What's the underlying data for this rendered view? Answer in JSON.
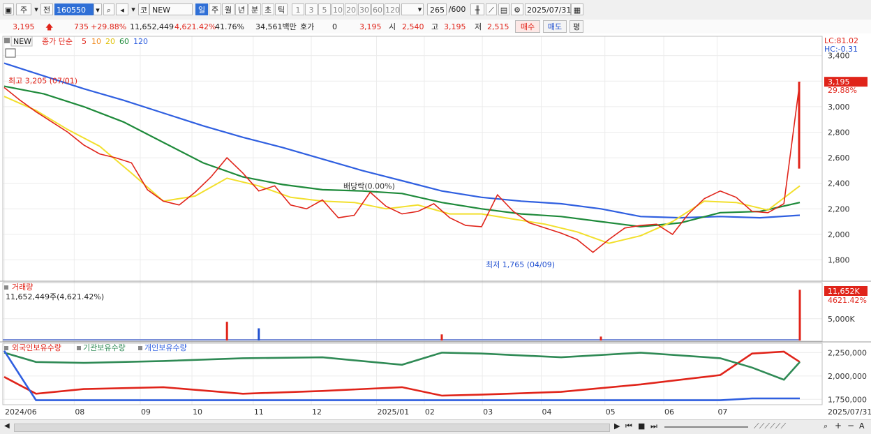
{
  "toolbar": {
    "market": "주",
    "prefix": "전",
    "code": "160550",
    "type_label": "코",
    "name": "NEW",
    "periods": [
      "일",
      "주",
      "월",
      "년",
      "분",
      "초",
      "틱"
    ],
    "intervals": [
      "1",
      "3",
      "5",
      "10",
      "20",
      "30",
      "60",
      "120"
    ],
    "count": "265",
    "count_max": "/600",
    "date": "2025/07/31"
  },
  "quote": {
    "price": "3,195",
    "change": "735",
    "change_pct": "+29.88%",
    "volume": "11,652,449",
    "volume_pct": "4,621.42%",
    "turnover": "41.76%",
    "amount": "34,561백만",
    "hoga_label": "호가",
    "hoga_value": "0",
    "hoga_price": "3,195",
    "open_label": "시",
    "open": "2,540",
    "high_label": "고",
    "high": "3,195",
    "low_label": "저",
    "low": "2,515",
    "buy_label": "매수",
    "sell_label": "매도",
    "avg_label": "평"
  },
  "colors": {
    "ma5": "#e0241a",
    "ma10": "#f08a1e",
    "ma20": "#f2df2c",
    "ma60": "#1e8a3a",
    "ma120": "#2f5fe0",
    "up": "#e0241a",
    "down": "#1f4fd0",
    "foreign": "#e0241a",
    "institution": "#2f8a55",
    "individual": "#2f5fe0"
  },
  "legend": {
    "name": "NEW",
    "price_legend": "종가 단순",
    "ma_periods": [
      "5",
      "10",
      "20",
      "60",
      "120"
    ],
    "volume_title": "거래량",
    "volume_value": "11,652,449주(4,621.42%)",
    "holding": [
      "외국인보유수량",
      "기관보유수량",
      "개인보유수량"
    ]
  },
  "chart_data": [
    {
      "type": "line",
      "title": "",
      "y_ticks": [
        "3,400",
        "3,200",
        "3,000",
        "2,800",
        "2,600",
        "2,400",
        "2,200",
        "2,000",
        "1,800"
      ],
      "x_ticks": [
        "2024/06",
        "08",
        "09",
        "10",
        "11",
        "12",
        "2025/01",
        "02",
        "03",
        "04",
        "05",
        "06",
        "07"
      ],
      "ylim": [
        1650,
        3540
      ],
      "lc": "LC:81.02",
      "hc": "HC:-0.31",
      "current_label": "3,195",
      "current_pct": "29.88%",
      "annotations": {
        "max": "최고 3,205 (07/01)",
        "min": "최저 1,765 (04/09)",
        "dividend": "배당락(0.00%)"
      },
      "series": [
        {
          "key": "close",
          "x": [
            0,
            0.02,
            0.04,
            0.06,
            0.08,
            0.1,
            0.12,
            0.14,
            0.16,
            0.18,
            0.2,
            0.22,
            0.24,
            0.26,
            0.28,
            0.3,
            0.32,
            0.34,
            0.36,
            0.38,
            0.4,
            0.42,
            0.44,
            0.46,
            0.48,
            0.5,
            0.52,
            0.54,
            0.56,
            0.58,
            0.6,
            0.62,
            0.64,
            0.66,
            0.68,
            0.7,
            0.72,
            0.74,
            0.76,
            0.78,
            0.8,
            0.82,
            0.84,
            0.86,
            0.88,
            0.9,
            0.92,
            0.94,
            0.96,
            0.98,
            1.0
          ],
          "values": [
            3150,
            3050,
            2960,
            2880,
            2800,
            2700,
            2630,
            2600,
            2560,
            2350,
            2260,
            2230,
            2330,
            2450,
            2600,
            2480,
            2340,
            2380,
            2230,
            2200,
            2270,
            2130,
            2150,
            2330,
            2220,
            2160,
            2180,
            2240,
            2130,
            2070,
            2060,
            2310,
            2180,
            2090,
            2050,
            2010,
            1960,
            1860,
            1960,
            2050,
            2070,
            2080,
            2000,
            2160,
            2280,
            2340,
            2290,
            2180,
            2170,
            2240,
            3195
          ]
        },
        {
          "key": "ma120",
          "x": [
            0,
            0.05,
            0.1,
            0.15,
            0.2,
            0.25,
            0.3,
            0.35,
            0.4,
            0.45,
            0.5,
            0.55,
            0.6,
            0.65,
            0.7,
            0.75,
            0.8,
            0.85,
            0.9,
            0.95,
            1.0
          ],
          "values": [
            3340,
            3240,
            3140,
            3050,
            2950,
            2850,
            2760,
            2680,
            2590,
            2500,
            2420,
            2340,
            2290,
            2260,
            2240,
            2200,
            2140,
            2130,
            2140,
            2130,
            2150
          ]
        },
        {
          "key": "ma60",
          "x": [
            0,
            0.05,
            0.1,
            0.15,
            0.2,
            0.25,
            0.3,
            0.35,
            0.4,
            0.45,
            0.5,
            0.55,
            0.6,
            0.65,
            0.7,
            0.75,
            0.8,
            0.85,
            0.9,
            0.95,
            1.0
          ],
          "values": [
            3160,
            3100,
            3000,
            2880,
            2720,
            2560,
            2450,
            2390,
            2350,
            2340,
            2320,
            2250,
            2200,
            2160,
            2140,
            2100,
            2060,
            2090,
            2170,
            2180,
            2250
          ]
        },
        {
          "key": "ma20",
          "x": [
            0,
            0.04,
            0.08,
            0.12,
            0.16,
            0.2,
            0.24,
            0.28,
            0.32,
            0.36,
            0.4,
            0.44,
            0.48,
            0.52,
            0.56,
            0.6,
            0.64,
            0.68,
            0.72,
            0.76,
            0.8,
            0.84,
            0.88,
            0.92,
            0.96,
            1.0
          ],
          "values": [
            3080,
            2970,
            2820,
            2690,
            2480,
            2260,
            2300,
            2440,
            2380,
            2290,
            2260,
            2250,
            2200,
            2230,
            2160,
            2160,
            2120,
            2080,
            2020,
            1930,
            1990,
            2100,
            2260,
            2250,
            2190,
            2380
          ]
        }
      ]
    },
    {
      "type": "bar",
      "title": "거래량",
      "y_ticks": [
        "5,000K"
      ],
      "current_label": "11,652K",
      "current_pct": "4621.42%",
      "ylim": [
        0,
        12500000
      ],
      "x": [
        0.28,
        0.32,
        0.55,
        0.75,
        1.0
      ],
      "values": [
        4300000,
        2800000,
        1400000,
        900000,
        11652449
      ]
    },
    {
      "type": "line",
      "title": "외국인보유수량",
      "y_ticks": [
        "2,250,000",
        "2,000,000",
        "1,750,000"
      ],
      "ylim": [
        1700000,
        2320000
      ],
      "series": [
        {
          "key": "foreign",
          "x": [
            0,
            0.04,
            0.1,
            0.2,
            0.3,
            0.4,
            0.5,
            0.55,
            0.6,
            0.7,
            0.8,
            0.9,
            0.94,
            0.98,
            1.0
          ],
          "values": [
            1990000,
            1810000,
            1860000,
            1880000,
            1810000,
            1840000,
            1880000,
            1790000,
            1800000,
            1830000,
            1910000,
            2010000,
            2240000,
            2260000,
            2150000
          ]
        },
        {
          "key": "institution",
          "x": [
            0,
            0.04,
            0.1,
            0.2,
            0.3,
            0.4,
            0.5,
            0.55,
            0.6,
            0.7,
            0.8,
            0.9,
            0.94,
            0.98,
            1.0
          ],
          "values": [
            2250000,
            2150000,
            2140000,
            2160000,
            2190000,
            2200000,
            2120000,
            2250000,
            2240000,
            2200000,
            2250000,
            2190000,
            2090000,
            1960000,
            2150000
          ]
        },
        {
          "key": "individual",
          "x": [
            0,
            0.04,
            0.1,
            0.2,
            0.3,
            0.4,
            0.5,
            0.55,
            0.6,
            0.7,
            0.8,
            0.9,
            0.94,
            0.98,
            1.0
          ],
          "values": [
            2270000,
            1740000,
            1740000,
            1740000,
            1740000,
            1740000,
            1740000,
            1740000,
            1740000,
            1740000,
            1740000,
            1740000,
            1760000,
            1760000,
            1760000
          ]
        }
      ]
    }
  ],
  "bottom": {
    "left_arrow": "◀",
    "controls": [
      "▶",
      "⏮",
      "■",
      "⏭",
      "+",
      "−",
      "A"
    ]
  }
}
